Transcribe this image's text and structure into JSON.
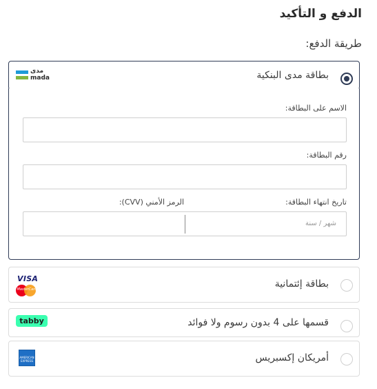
{
  "page": {
    "title": "الدفع و التأكيد",
    "subtitle": "طريقة الدفع:"
  },
  "payment_methods": [
    {
      "label": "بطاقة مدى البنكية",
      "selected": true,
      "logo": "mada-logo",
      "logo_text": "مدى",
      "logo_text_latin": "mada"
    },
    {
      "label": "بطاقة إئتمانية",
      "selected": false,
      "logo": "visa-mastercard-logo",
      "logo_text": "VISA",
      "logo_subtext": "MasterCard"
    },
    {
      "label": "قسمها على 4 بدون رسوم ولا فوائد",
      "selected": false,
      "logo": "tabby-logo",
      "logo_text": "tabby"
    },
    {
      "label": "أمريكان إكسبريس",
      "selected": false,
      "logo": "amex-logo",
      "logo_text": "AMERICAN EXPRESS"
    }
  ],
  "card_form": {
    "name_label": "الاسم على البطاقة:",
    "name_value": "",
    "number_label": "رقم البطاقة:",
    "number_value": "",
    "expiry_label": "تاريخ انتهاء البطاقة:",
    "expiry_placeholder": "شهر / سنة",
    "cvv_label": "الرمز الأمني (CVV):",
    "cvv_value": ""
  },
  "colors": {
    "accent": "#2f3b56",
    "border": "#dcdcdc",
    "mada_blue": "#1f9bd7",
    "mada_green": "#84b740",
    "tabby_green": "#3bffb0",
    "visa_blue": "#1a1f71",
    "amex_blue": "#1f6fc5"
  }
}
